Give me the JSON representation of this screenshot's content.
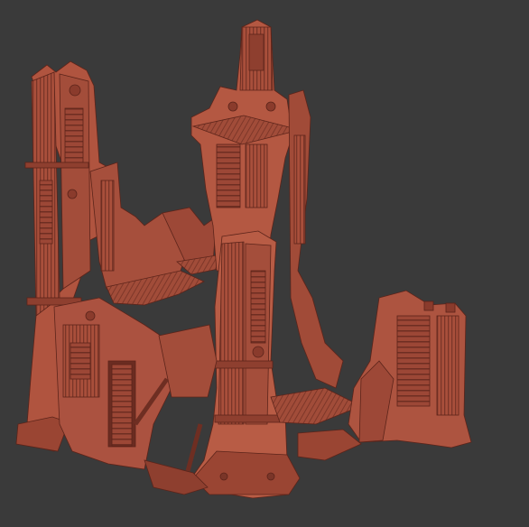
{
  "viewport": {
    "background_color": "#3a3a3a",
    "model_color": "#b0543f",
    "shadow_color": "#6e2e22",
    "highlight_color": "#c96a53"
  }
}
